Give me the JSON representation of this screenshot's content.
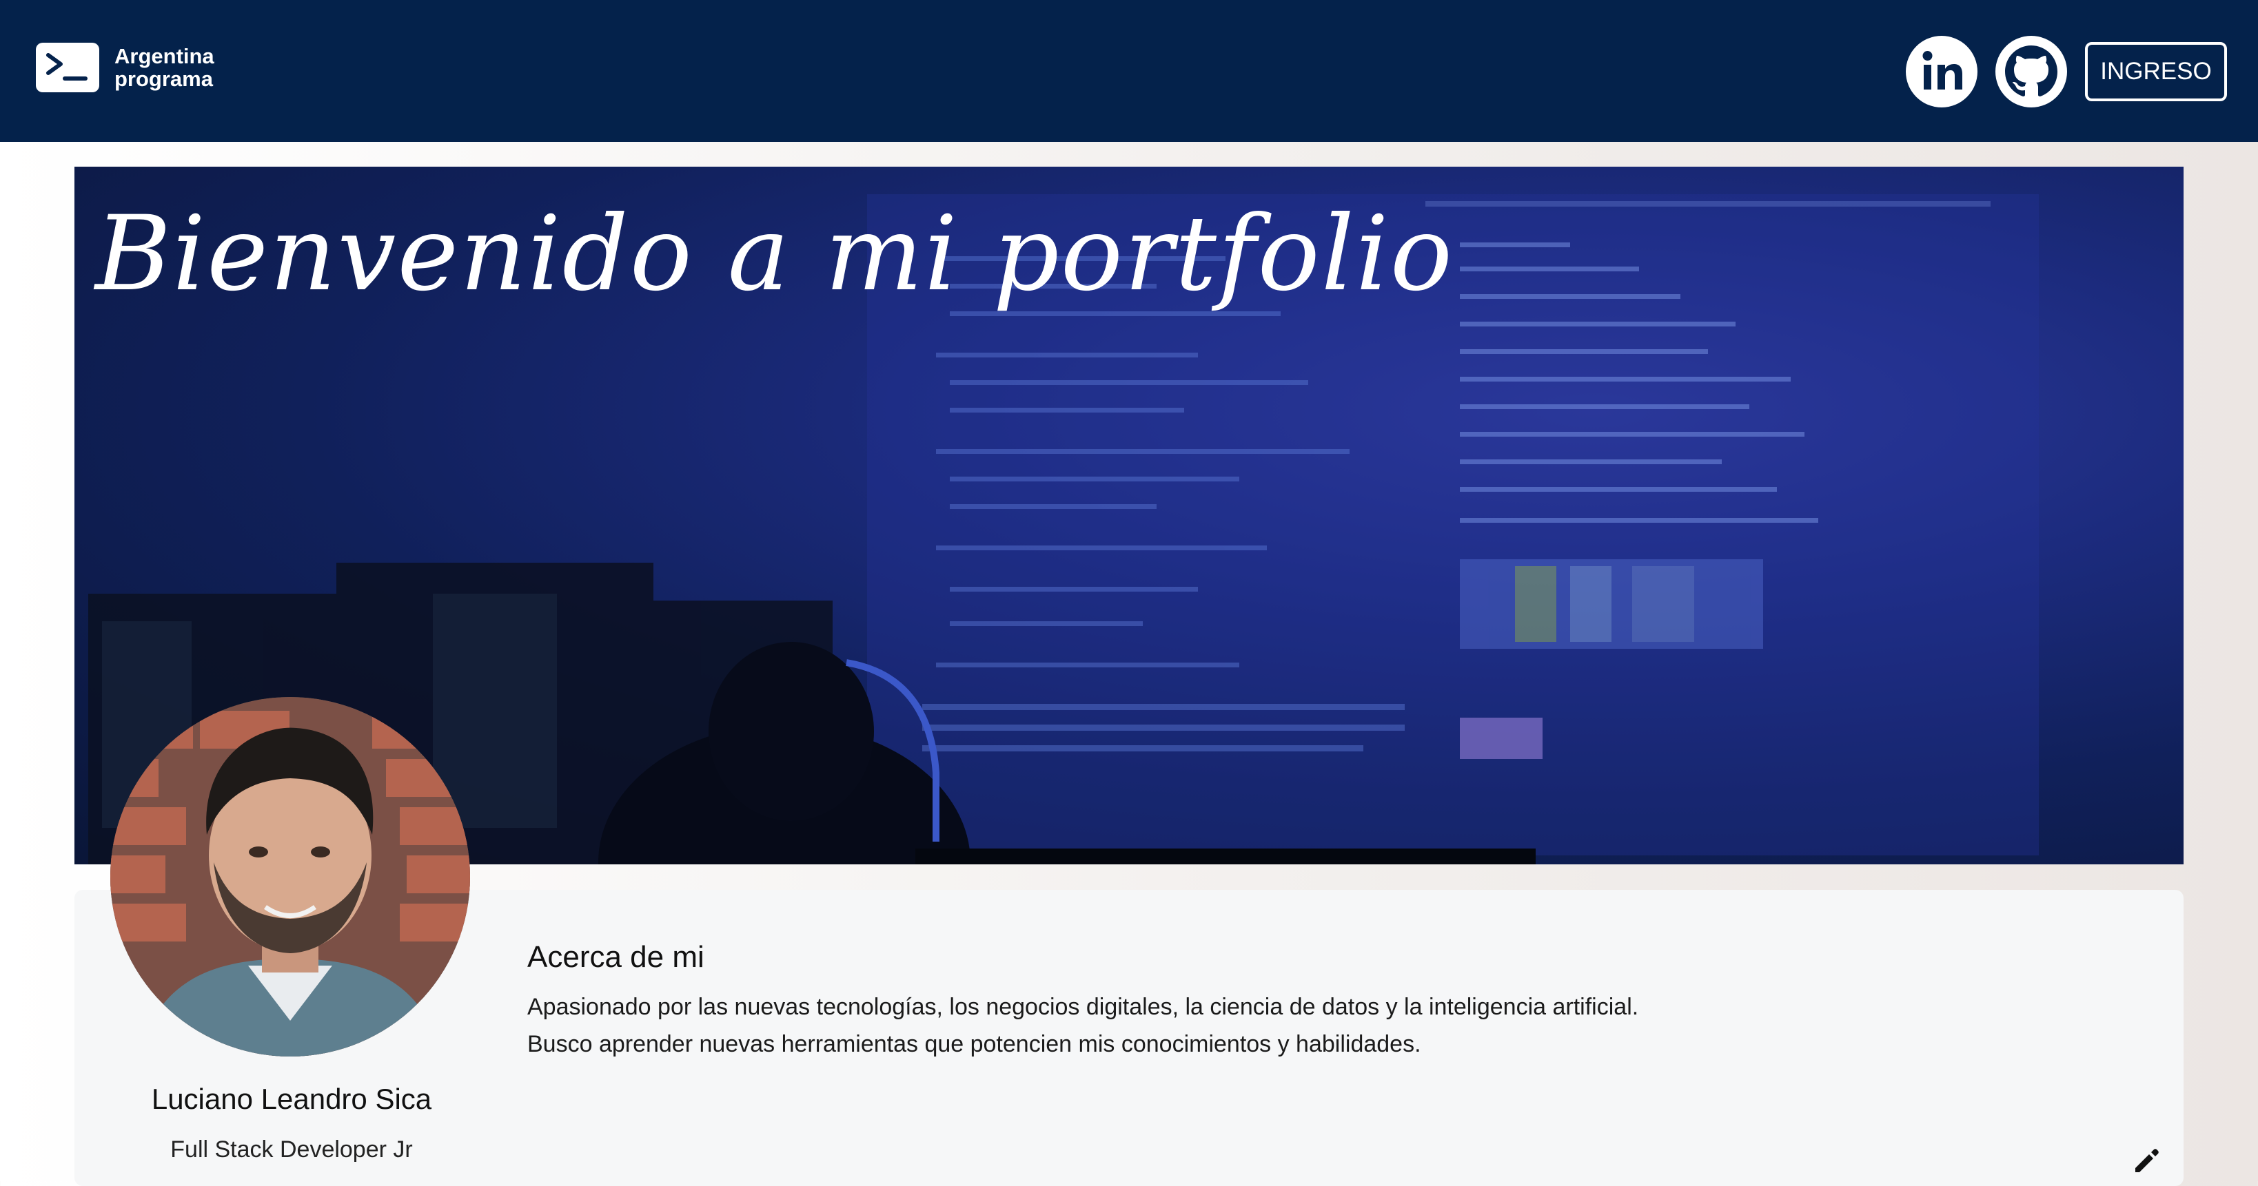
{
  "navbar": {
    "brand_line1": "Argentina",
    "brand_line2": "programa",
    "brand_icon": "terminal-icon",
    "linkedin_icon": "linkedin-icon",
    "github_icon": "github-icon",
    "login_label": "INGRESO"
  },
  "banner": {
    "title": "Bienvenido a mi portfolio"
  },
  "profile": {
    "name": "Luciano Leandro Sica",
    "role": "Full Stack Developer Jr"
  },
  "about": {
    "title": "Acerca de mi",
    "line1": "Apasionado por las nuevas tecnologías, los negocios digitales, la ciencia de datos y la inteligencia artificial.",
    "line2": "Busco aprender nuevas herramientas que potencien mis conocimientos y habilidades."
  },
  "colors": {
    "navbar_bg": "#04224b",
    "banner_accent": "#1c2b7e",
    "card_bg": "#f6f7f8"
  },
  "icons": {
    "edit": "pencil-icon"
  }
}
